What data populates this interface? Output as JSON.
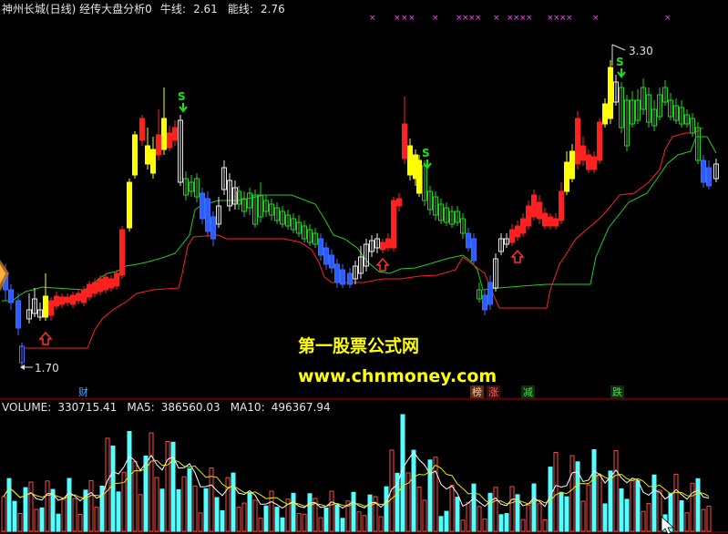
{
  "header": {
    "title": "神州长城(日线) 经传大盘分析0",
    "niu_label": "牛线:",
    "niu_value": "2.61",
    "neng_label": "能线:",
    "neng_value": "2.76"
  },
  "annotations": {
    "high_price": "3.30",
    "low_price": "1.70",
    "sell_mark": "S"
  },
  "watermark": {
    "line1": "第一股票公式网",
    "line2": "www.chnmoney.com"
  },
  "signals": {
    "cai": "财",
    "bang": "榜",
    "zhang": "涨",
    "jian": "减",
    "die": "跌"
  },
  "volume": {
    "label": "VOLUME:",
    "value": "330715.41",
    "ma5_label": "MA5:",
    "ma5_value": "386560.03",
    "ma10_label": "MA10:",
    "ma10_value": "496367.94"
  },
  "colors": {
    "background": "#000000",
    "up_candle": "#ff2020",
    "down_candle": "#54ffff",
    "strong_candle": "#ffff00",
    "support_line": "#ff2020",
    "resistance_line": "#22cc22",
    "grid": "#880000",
    "magenta_marks": "#ff40ff"
  }
}
